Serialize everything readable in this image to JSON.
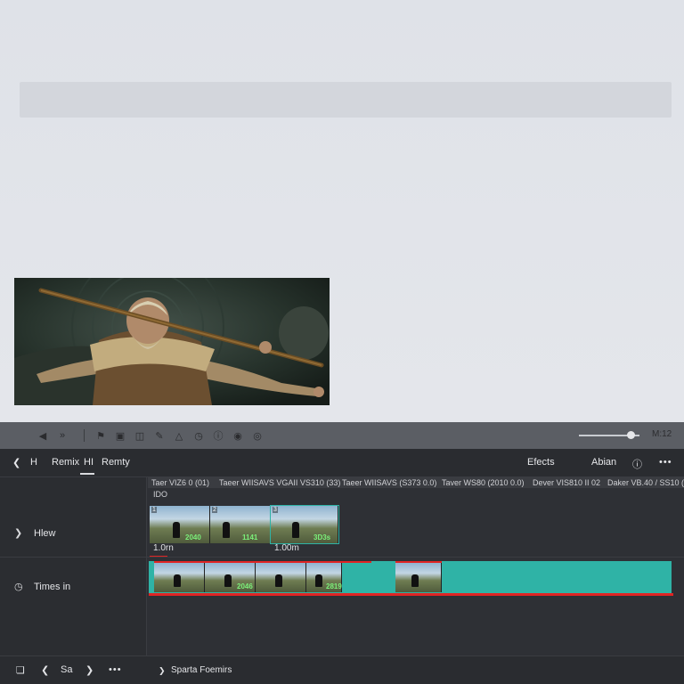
{
  "toolbar": {
    "icons": [
      "arrow-left-icon",
      "rewind-icon",
      "flag-icon",
      "box-icon",
      "panel-icon",
      "pen-icon",
      "shape-icon",
      "clock-icon",
      "info-icon",
      "record-icon",
      "record-alt-icon"
    ],
    "right_label": "M:12"
  },
  "header": {
    "back_icon": "chevron-left-icon",
    "item_h1": "H",
    "remix_label": "Remix",
    "hi_label": "HI",
    "remty_label": "Remty",
    "effects_label": "Efects",
    "abian_label": "Abian",
    "more_icon": "ellipsis-icon"
  },
  "ruler": {
    "labels": [
      "Taer VIZ6 0 (01)",
      "Taeer WIISAVS VGAII VS310 (33)",
      "Taeer WIISAVS (S373 0.0)",
      "Taver WS80 (2010 0.0)",
      "Dever VIS810 II 02",
      "Daker VB.40 / SS10 (1"
    ],
    "sublabel": "IDO"
  },
  "tracks": {
    "hlew_label": "Hlew",
    "times_label": "Times in",
    "clip1_time": "1.0rn",
    "clip2_time": "1.00m",
    "clip1_tags": [
      "2040",
      "1141"
    ],
    "clip2_tags": [
      "3D3s"
    ],
    "clip3_tags": [
      "",
      "2046",
      "",
      "2046",
      "2819"
    ],
    "clip4_tags": [
      ""
    ]
  },
  "bottom": {
    "sa_label": "Sa",
    "sparta_label": "Sparta Foemirs"
  },
  "colors": {
    "teal": "#2fb3a6",
    "red": "#e02424",
    "panel": "#2e3035"
  }
}
